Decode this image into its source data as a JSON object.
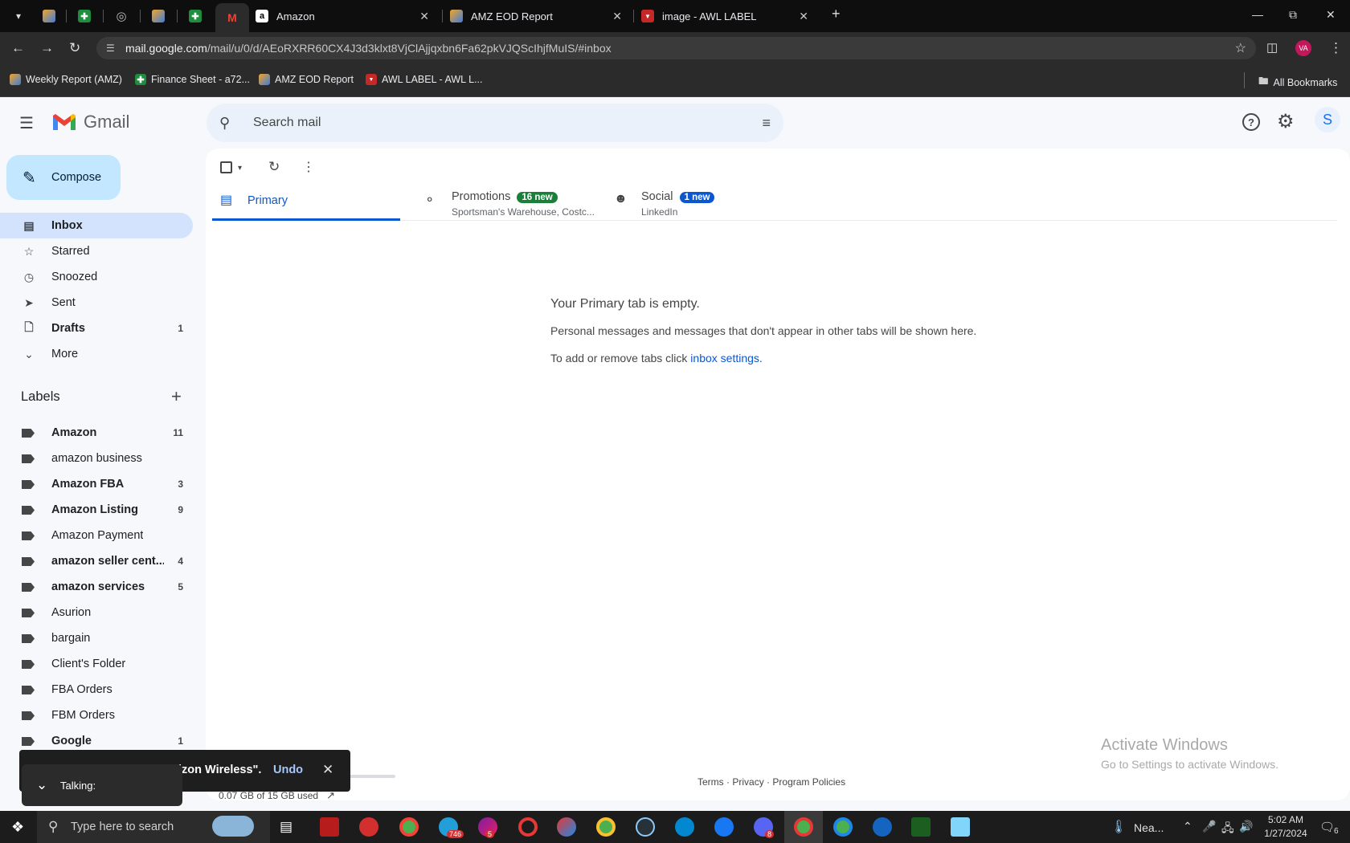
{
  "browser": {
    "tabs": [
      {
        "label": "Amazon",
        "icon": "amazon-icon"
      },
      {
        "label": "AMZ EOD Report",
        "icon": "zapier-icon"
      },
      {
        "label": "image - AWL LABEL",
        "icon": "awl-icon"
      }
    ],
    "url_host": "mail.google.com",
    "url_path": "/mail/u/0/d/AEoRXRR60CX4J3d3klxt8VjClAjjqxbn6Fa62pkVJQScIhjfMuIS/#inbox",
    "profile_initials": "VA",
    "bookmarks": [
      "Weekly Report (AMZ)",
      "Finance Sheet - a72...",
      "AMZ EOD Report",
      "AWL LABEL - AWL L..."
    ],
    "all_bookmarks": "All Bookmarks"
  },
  "gmail": {
    "app_name": "Gmail",
    "search_placeholder": "Search mail",
    "avatar_initial": "S",
    "compose_label": "Compose",
    "nav": [
      {
        "label": "Inbox",
        "count": ""
      },
      {
        "label": "Starred",
        "count": ""
      },
      {
        "label": "Snoozed",
        "count": ""
      },
      {
        "label": "Sent",
        "count": ""
      },
      {
        "label": "Drafts",
        "count": "1"
      },
      {
        "label": "More",
        "count": ""
      }
    ],
    "labels_title": "Labels",
    "labels": [
      {
        "label": "Amazon",
        "count": "11"
      },
      {
        "label": "amazon business",
        "count": ""
      },
      {
        "label": "Amazon FBA",
        "count": "3"
      },
      {
        "label": "Amazon Listing",
        "count": "9"
      },
      {
        "label": "Amazon Payment",
        "count": ""
      },
      {
        "label": "amazon seller cent...",
        "count": "4"
      },
      {
        "label": "amazon services",
        "count": "5"
      },
      {
        "label": "Asurion",
        "count": ""
      },
      {
        "label": "bargain",
        "count": ""
      },
      {
        "label": "Client's Folder",
        "count": ""
      },
      {
        "label": "FBA Orders",
        "count": ""
      },
      {
        "label": "FBM Orders",
        "count": ""
      },
      {
        "label": "Google",
        "count": "1"
      }
    ],
    "tabs": [
      {
        "title": "Primary",
        "sub": "",
        "badge": ""
      },
      {
        "title": "Promotions",
        "sub": "Sportsman's Warehouse, Costc...",
        "badge": "16 new"
      },
      {
        "title": "Social",
        "sub": "LinkedIn",
        "badge": "1 new"
      }
    ],
    "empty_title": "Your Primary tab is empty.",
    "empty_line1": "Personal messages and messages that don't appear in other tabs will be shown here.",
    "empty_line2_prefix": "To add or remove tabs click ",
    "empty_link": "inbox settings.",
    "storage_used": "0.07 GB of 15 GB used",
    "storage_fraction": 0.0047,
    "footer_terms": "Terms",
    "footer_privacy": "Privacy",
    "footer_policies": "Program Policies",
    "footer_sep": "·",
    "snackbar_text": "izon Wireless\".",
    "snackbar_undo": "Undo",
    "talking_label": "Talking:"
  },
  "watermark": {
    "title": "Activate Windows",
    "sub": "Go to Settings to activate Windows."
  },
  "taskbar": {
    "search_placeholder": "Type here to search",
    "weather": "Nea...",
    "time": "5:02 AM",
    "date": "1/27/2024",
    "notif_count": "6",
    "badge_telegram": "746",
    "badge_messenger": "5",
    "badge_discord": "8"
  },
  "colors": {
    "accent": "#0b57d0",
    "compose": "#c2e7ff",
    "nav_active": "#d3e3fd",
    "promo_badge": "#188038",
    "social_badge": "#0b57d0"
  }
}
